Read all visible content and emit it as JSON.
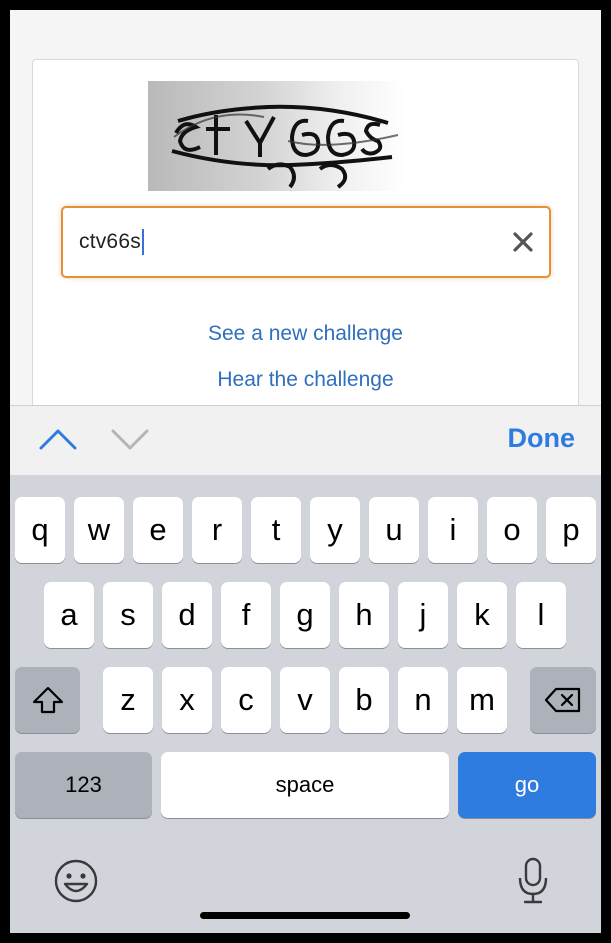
{
  "captcha": {
    "answer_value": "ctv66s"
  },
  "links": {
    "new_challenge": "See a new challenge",
    "hear_challenge": "Hear the challenge"
  },
  "accessory": {
    "done_label": "Done"
  },
  "keyboard": {
    "row1": [
      "q",
      "w",
      "e",
      "r",
      "t",
      "y",
      "u",
      "i",
      "o",
      "p"
    ],
    "row2": [
      "a",
      "s",
      "d",
      "f",
      "g",
      "h",
      "j",
      "k",
      "l"
    ],
    "row3": [
      "z",
      "x",
      "c",
      "v",
      "b",
      "n",
      "m"
    ],
    "numbers_label": "123",
    "space_label": "space",
    "go_label": "go"
  },
  "icons": {
    "clear": "close-icon",
    "prev": "chevron-up-icon",
    "next": "chevron-down-icon",
    "shift": "shift-icon",
    "delete": "backspace-icon",
    "emoji": "emoji-icon",
    "mic": "microphone-icon"
  },
  "colors": {
    "link": "#2f6fbe",
    "focus_border": "#e5913a",
    "go_key": "#2f7ce0",
    "keyboard_bg": "#d1d4db"
  }
}
